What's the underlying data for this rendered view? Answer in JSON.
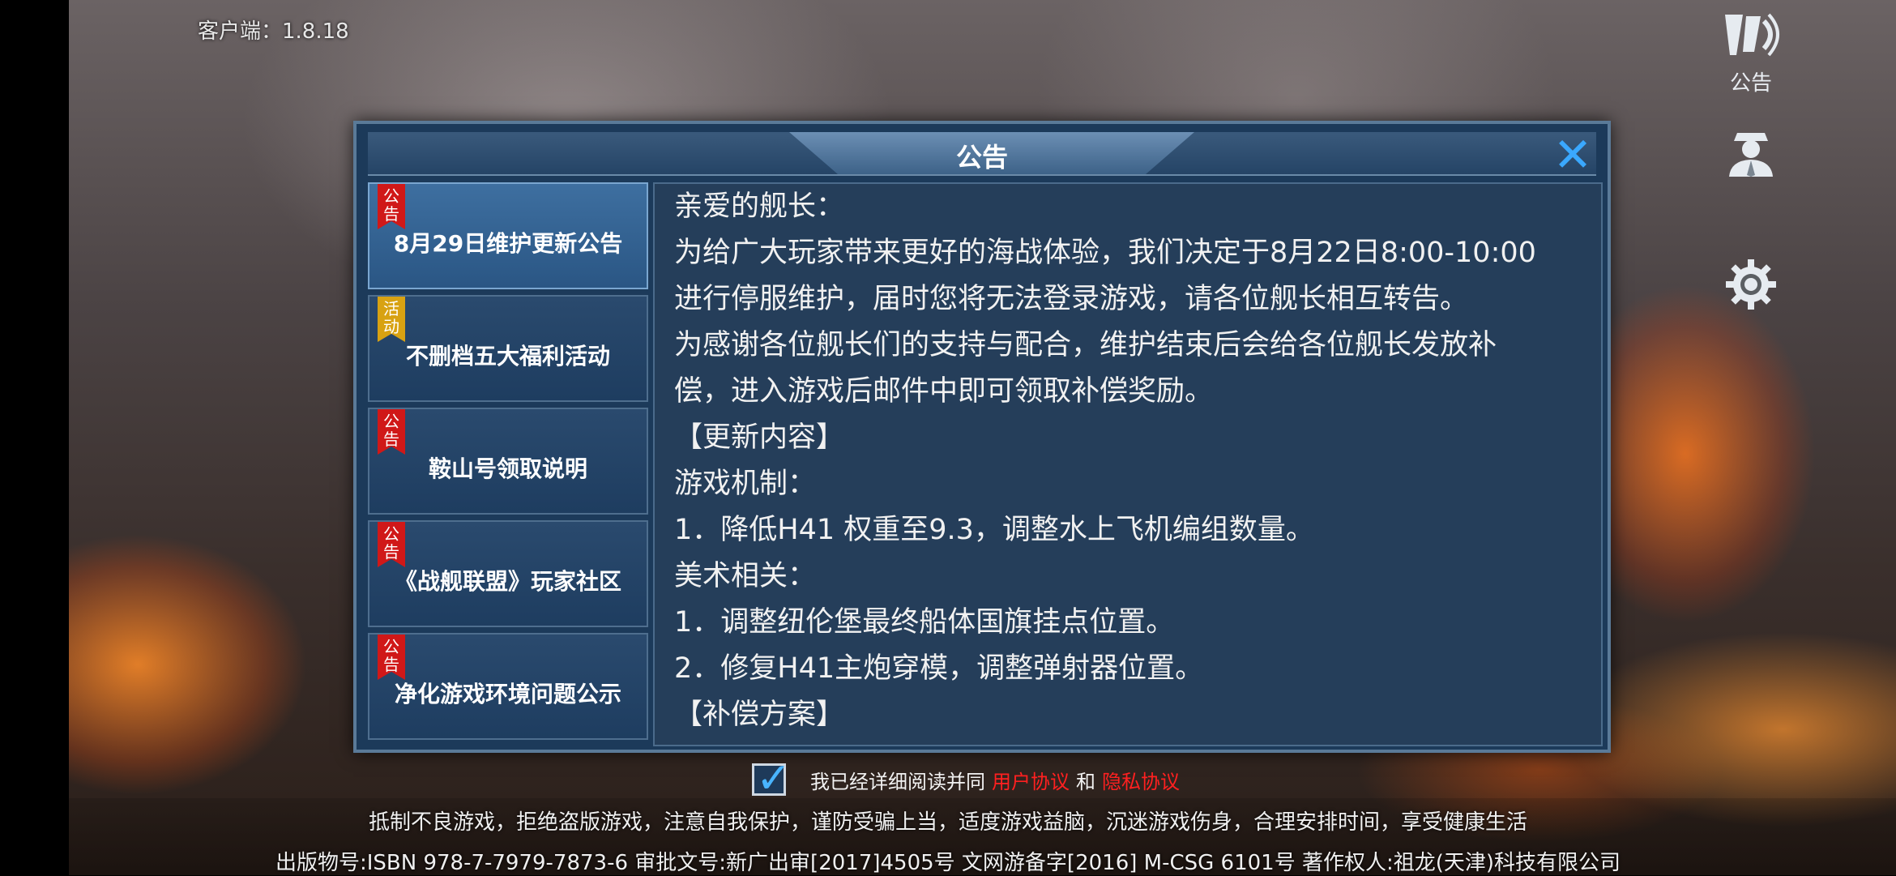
{
  "app": {
    "version_label": "客户端：1.8.18"
  },
  "side_menu": {
    "announce_label": "公告"
  },
  "dialog": {
    "title": "公告",
    "items": [
      {
        "tag": "公告",
        "tag_color": "#d01818",
        "title": "8月29日维护更新公告",
        "active": true
      },
      {
        "tag": "活动",
        "tag_color": "#d8a212",
        "title": "不删档五大福利活动",
        "active": false
      },
      {
        "tag": "公告",
        "tag_color": "#d01818",
        "title": "鞍山号领取说明",
        "active": false
      },
      {
        "tag": "公告",
        "tag_color": "#d01818",
        "title": "《战舰联盟》玩家社区",
        "active": false
      },
      {
        "tag": "公告",
        "tag_color": "#d01818",
        "title": "净化游戏环境问题公示",
        "active": false
      }
    ],
    "content_lines": [
      "亲爱的舰长：",
      "为给广大玩家带来更好的海战体验，我们决定于8月22日8:00-10:00",
      "进行停服维护，届时您将无法登录游戏，请各位舰长相互转告。",
      "为感谢各位舰长们的支持与配合，维护结束后会给各位舰长发放补",
      "偿，进入游戏后邮件中即可领取补偿奖励。",
      "【更新内容】",
      "游戏机制：",
      "1．降低H41 权重至9.3，调整水上飞机编组数量。",
      "美术相关：",
      "1．调整纽伦堡最终船体国旗挂点位置。",
      "2．修复H41主炮穿模，调整弹射器位置。",
      "【补偿方案】"
    ]
  },
  "agreement": {
    "checked": true,
    "text": "我已经详细阅读并同",
    "user_agreement": "用户协议",
    "and": "和",
    "privacy_policy": "隐私协议"
  },
  "footer": {
    "health_notice": "抵制不良游戏，拒绝盗版游戏，注意自我保护，谨防受骗上当，适度游戏益脑，沉迷游戏伤身，合理安排时间，享受健康生活",
    "license_info": "出版物号:ISBN 978-7-7979-7873-6 审批文号:新广出审[2017]4505号 文网游备字[2016] M-CSG 6101号 著作权人:祖龙(天津)科技有限公司"
  },
  "colors": {
    "accent": "#3aa8ff",
    "link_red": "#ff2020",
    "dialog_bg": "#1c3a5a"
  },
  "icons": [
    "game-logo-icon",
    "captain-avatar-icon",
    "gear-icon",
    "close-icon",
    "checkmark-icon"
  ]
}
